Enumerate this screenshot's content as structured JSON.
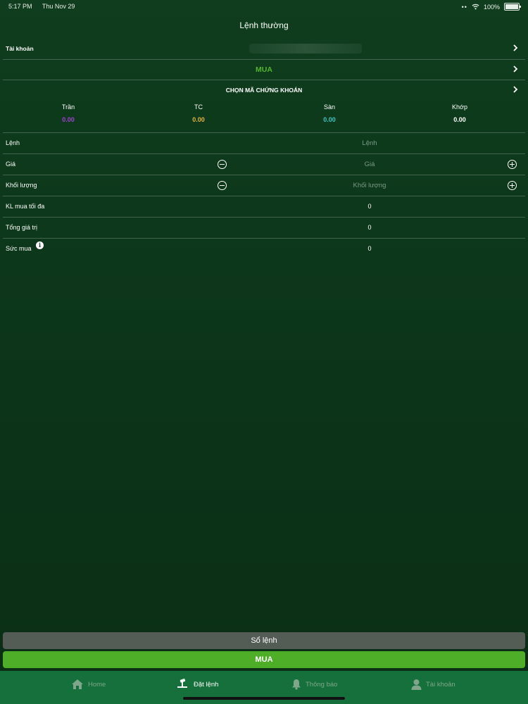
{
  "status_bar": {
    "time": "5:17 PM",
    "date": "Thu Nov 29",
    "battery": "100%",
    "icons": [
      "signal-dots-icon",
      "wifi-icon",
      "battery-icon"
    ]
  },
  "nav": {
    "title": "Lệnh thường"
  },
  "account": {
    "label": "Tài khoản"
  },
  "side": {
    "label": "MUA",
    "color": "#55b62d"
  },
  "stock": {
    "label": "CHỌN MÃ CHỨNG KHOÁN"
  },
  "prices": [
    {
      "label": "Trần",
      "value": "0.00",
      "color": "#a040d0"
    },
    {
      "label": "TC",
      "value": "0.00",
      "color": "#e0b23a"
    },
    {
      "label": "Sàn",
      "value": "0.00",
      "color": "#3ac3c0"
    },
    {
      "label": "Khớp",
      "value": "0.00",
      "color": "#ffffff"
    }
  ],
  "form": {
    "order": {
      "label": "Lệnh",
      "placeholder": "Lệnh"
    },
    "price": {
      "label": "Giá",
      "placeholder": "Giá"
    },
    "volume": {
      "label": "Khối lượng",
      "placeholder": "Khối lượng"
    },
    "max_buy": {
      "label": "KL mua tối đa",
      "value": "0"
    },
    "total": {
      "label": "Tổng giá trị",
      "value": "0"
    },
    "buying_power": {
      "label": "Sức mua",
      "value": "0",
      "info_icon": "i"
    }
  },
  "buttons": {
    "order_book": "Sổ lệnh",
    "submit": "MUA"
  },
  "tabs": [
    {
      "label": "Home",
      "icon": "home-icon"
    },
    {
      "label": "Đặt lệnh",
      "icon": "order-icon",
      "active": true
    },
    {
      "label": "Thông báo",
      "icon": "bell-icon"
    },
    {
      "label": "Tài khoản",
      "icon": "user-icon"
    }
  ],
  "colors": {
    "background": "#0c3419",
    "tab_bar": "#16703b",
    "accent": "#4fae28",
    "secondary_button": "#545c56"
  }
}
